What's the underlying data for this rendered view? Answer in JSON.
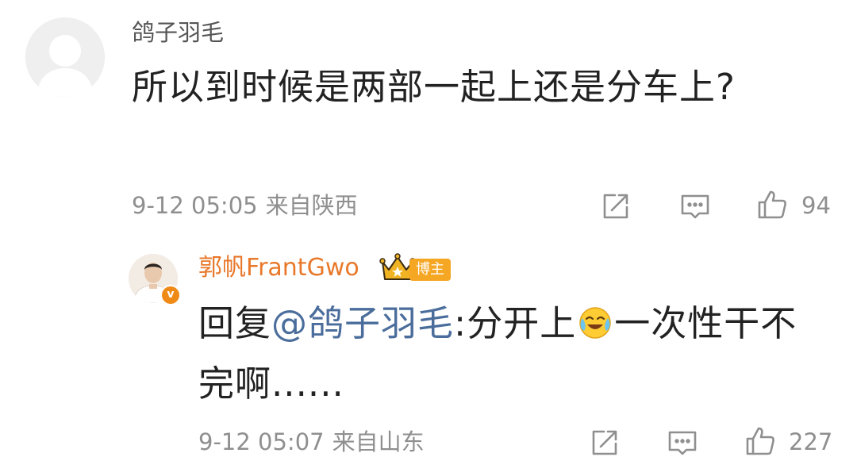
{
  "comment": {
    "username": "鸽子羽毛",
    "text": "所以到时候是两部一起上还是分车上?",
    "time": "9-12 05:05",
    "source": "来自陕西",
    "like_count": "94",
    "icons": [
      "default-avatar",
      "share-icon",
      "comment-icon",
      "like-icon"
    ]
  },
  "reply": {
    "username": "郭帆FrantGwo",
    "badge_label": "博主",
    "prefix": "回复",
    "mention": "@鸽子羽毛",
    "text_before_emoji": ":分开上",
    "emoji": "laugh-cry-emoji",
    "text_after_emoji": "一次性干不完啊......",
    "time": "9-12 05:07",
    "source": "来自山东",
    "like_count": "227",
    "icons": [
      "crown-icon",
      "verified-icon",
      "share-icon",
      "comment-icon",
      "like-icon"
    ]
  },
  "colors": {
    "username_gray": "#555555",
    "meta_gray": "#8f8f8f",
    "blogger_orange": "#e8782a",
    "mention_blue": "#4a6d9c",
    "badge_bg": "#f5a623"
  }
}
